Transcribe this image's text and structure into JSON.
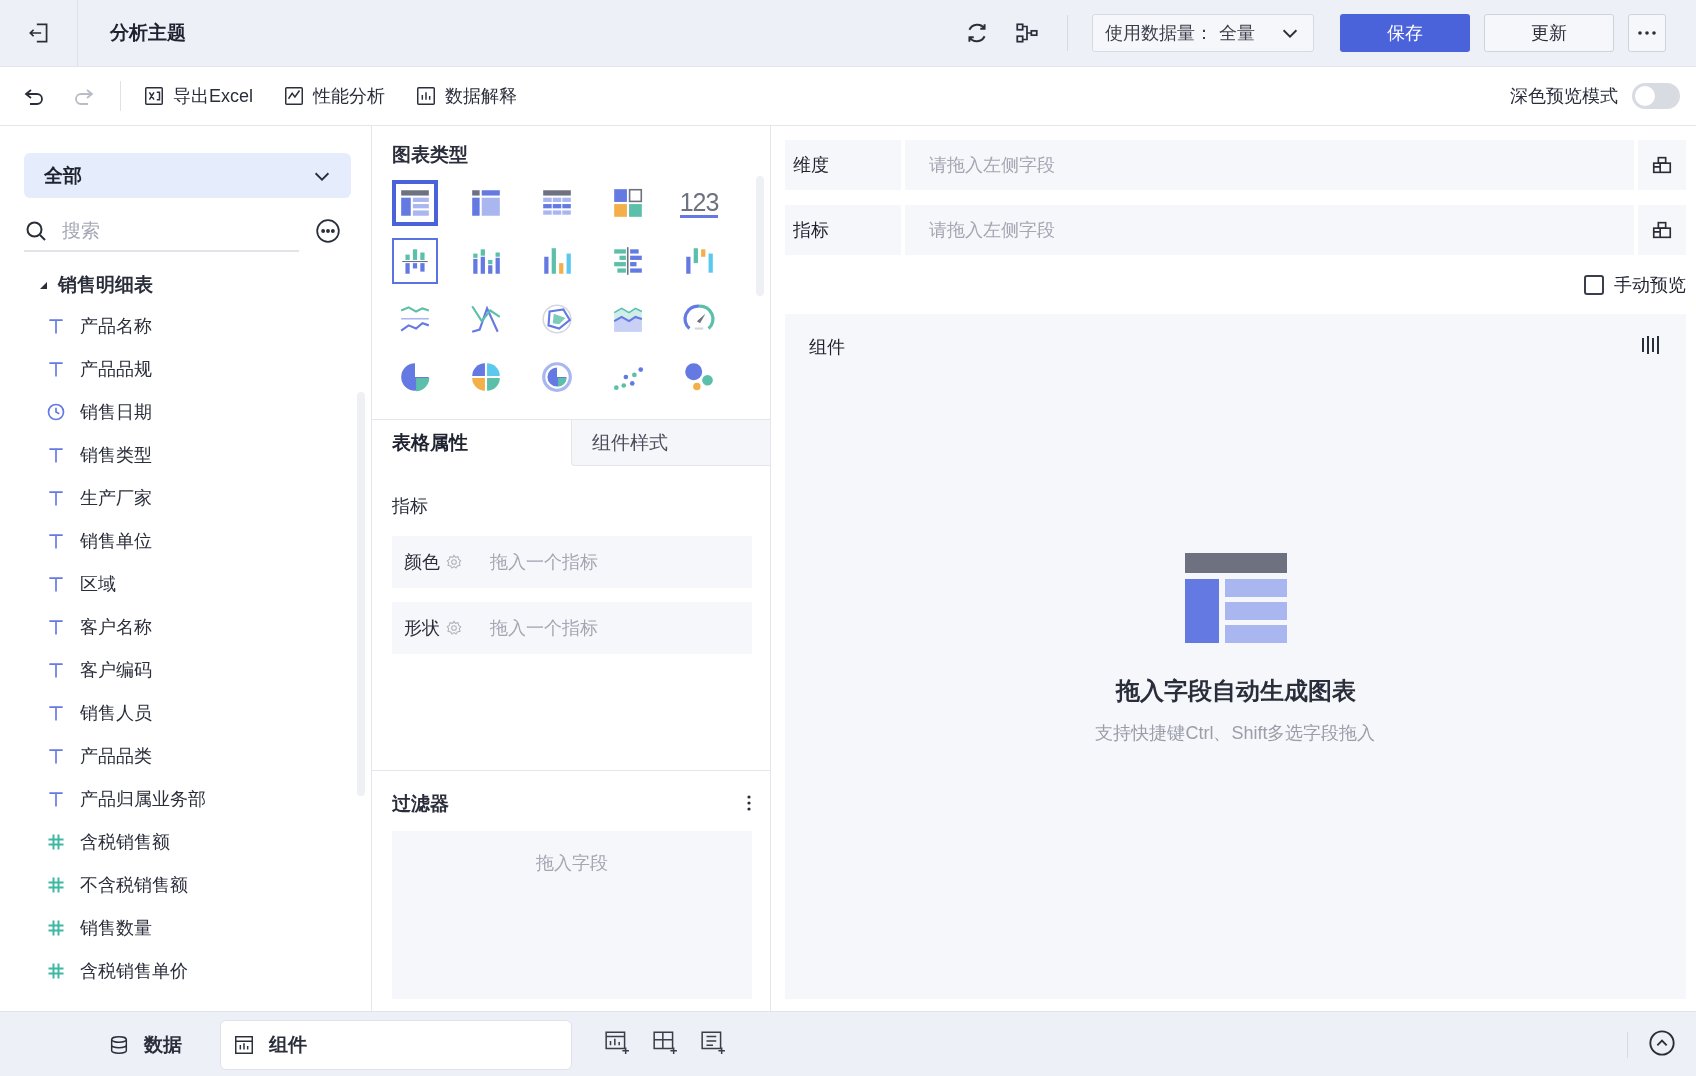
{
  "header": {
    "title": "分析主题",
    "data_volume": {
      "label": "使用数据量：",
      "value": "全量"
    },
    "buttons": [
      {
        "label": "保存",
        "kind": "primary"
      },
      {
        "label": "更新",
        "kind": "default"
      }
    ]
  },
  "toolbar": {
    "history": [
      {
        "kind": "undo",
        "disabled": false
      },
      {
        "kind": "redo",
        "disabled": true
      }
    ],
    "actions": [
      {
        "label": "导出Excel",
        "kind": "excel"
      },
      {
        "label": "性能分析",
        "kind": "performance"
      },
      {
        "label": "数据解释",
        "kind": "explain"
      }
    ],
    "dark_preview": {
      "label": "深色预览模式",
      "on": false
    }
  },
  "sidebar": {
    "scope": "全部",
    "search": {
      "placeholder": "搜索"
    },
    "tree": [
      {
        "label": "销售明细表",
        "expanded": true,
        "children": [
          {
            "label": "产品名称",
            "kind": "text"
          },
          {
            "label": "产品品规",
            "kind": "text"
          },
          {
            "label": "销售日期",
            "kind": "date"
          },
          {
            "label": "销售类型",
            "kind": "text"
          },
          {
            "label": "生产厂家",
            "kind": "text"
          },
          {
            "label": "销售单位",
            "kind": "text"
          },
          {
            "label": "区域",
            "kind": "text"
          },
          {
            "label": "客户名称",
            "kind": "text"
          },
          {
            "label": "客户编码",
            "kind": "text"
          },
          {
            "label": "销售人员",
            "kind": "text"
          },
          {
            "label": "产品品类",
            "kind": "text"
          },
          {
            "label": "产品归属业务部",
            "kind": "text"
          },
          {
            "label": "含税销售额",
            "kind": "number"
          },
          {
            "label": "不含税销售额",
            "kind": "number"
          },
          {
            "label": "销售数量",
            "kind": "number"
          },
          {
            "label": "含税销售单价",
            "kind": "number"
          }
        ]
      }
    ]
  },
  "chart_types": {
    "title": "图表类型",
    "items": [
      {
        "kind": "table",
        "selected": true,
        "hovered": false
      },
      {
        "kind": "cross-table",
        "selected": false,
        "hovered": false
      },
      {
        "kind": "detail-table",
        "selected": false,
        "hovered": false
      },
      {
        "kind": "blocks",
        "selected": false,
        "hovered": false
      },
      {
        "kind": "kpi",
        "label": "123",
        "selected": false,
        "hovered": false
      },
      {
        "kind": "split-bar",
        "selected": false,
        "hovered": true
      },
      {
        "kind": "stacked-bar",
        "selected": false,
        "hovered": false
      },
      {
        "kind": "column",
        "selected": false,
        "hovered": false
      },
      {
        "kind": "horizontal-bar",
        "selected": false,
        "hovered": false
      },
      {
        "kind": "range",
        "selected": false,
        "hovered": false
      },
      {
        "kind": "split-line",
        "selected": false,
        "hovered": false
      },
      {
        "kind": "line",
        "selected": false,
        "hovered": false
      },
      {
        "kind": "radar",
        "selected": false,
        "hovered": false
      },
      {
        "kind": "area",
        "selected": false,
        "hovered": false
      },
      {
        "kind": "gauge",
        "selected": false,
        "hovered": false
      },
      {
        "kind": "pie",
        "selected": false,
        "hovered": false
      },
      {
        "kind": "multi-pie",
        "selected": false,
        "hovered": false
      },
      {
        "kind": "ring",
        "selected": false,
        "hovered": false
      },
      {
        "kind": "scatter",
        "selected": false,
        "hovered": false
      },
      {
        "kind": "bubble",
        "selected": false,
        "hovered": false
      }
    ]
  },
  "property_tabs": [
    {
      "label": "表格属性",
      "selected": true
    },
    {
      "label": "组件样式",
      "selected": false
    }
  ],
  "properties": {
    "section": "指标",
    "slots": [
      {
        "label": "颜色",
        "hint": "拖入一个指标"
      },
      {
        "label": "形状",
        "hint": "拖入一个指标"
      }
    ]
  },
  "filter": {
    "title": "过滤器",
    "hint": "拖入字段"
  },
  "shelves": [
    {
      "label": "维度",
      "hint": "请拖入左侧字段"
    },
    {
      "label": "指标",
      "hint": "请拖入左侧字段"
    }
  ],
  "manual_preview": {
    "label": "手动预览",
    "checked": false
  },
  "component": {
    "title": "组件",
    "empty_title": "拖入字段自动生成图表",
    "empty_hint": "支持快捷键Ctrl、Shift多选字段拖入"
  },
  "bottom_tabs": [
    {
      "label": "数据",
      "kind": "data",
      "selected": false
    },
    {
      "label": "组件",
      "kind": "component",
      "selected": true
    }
  ]
}
